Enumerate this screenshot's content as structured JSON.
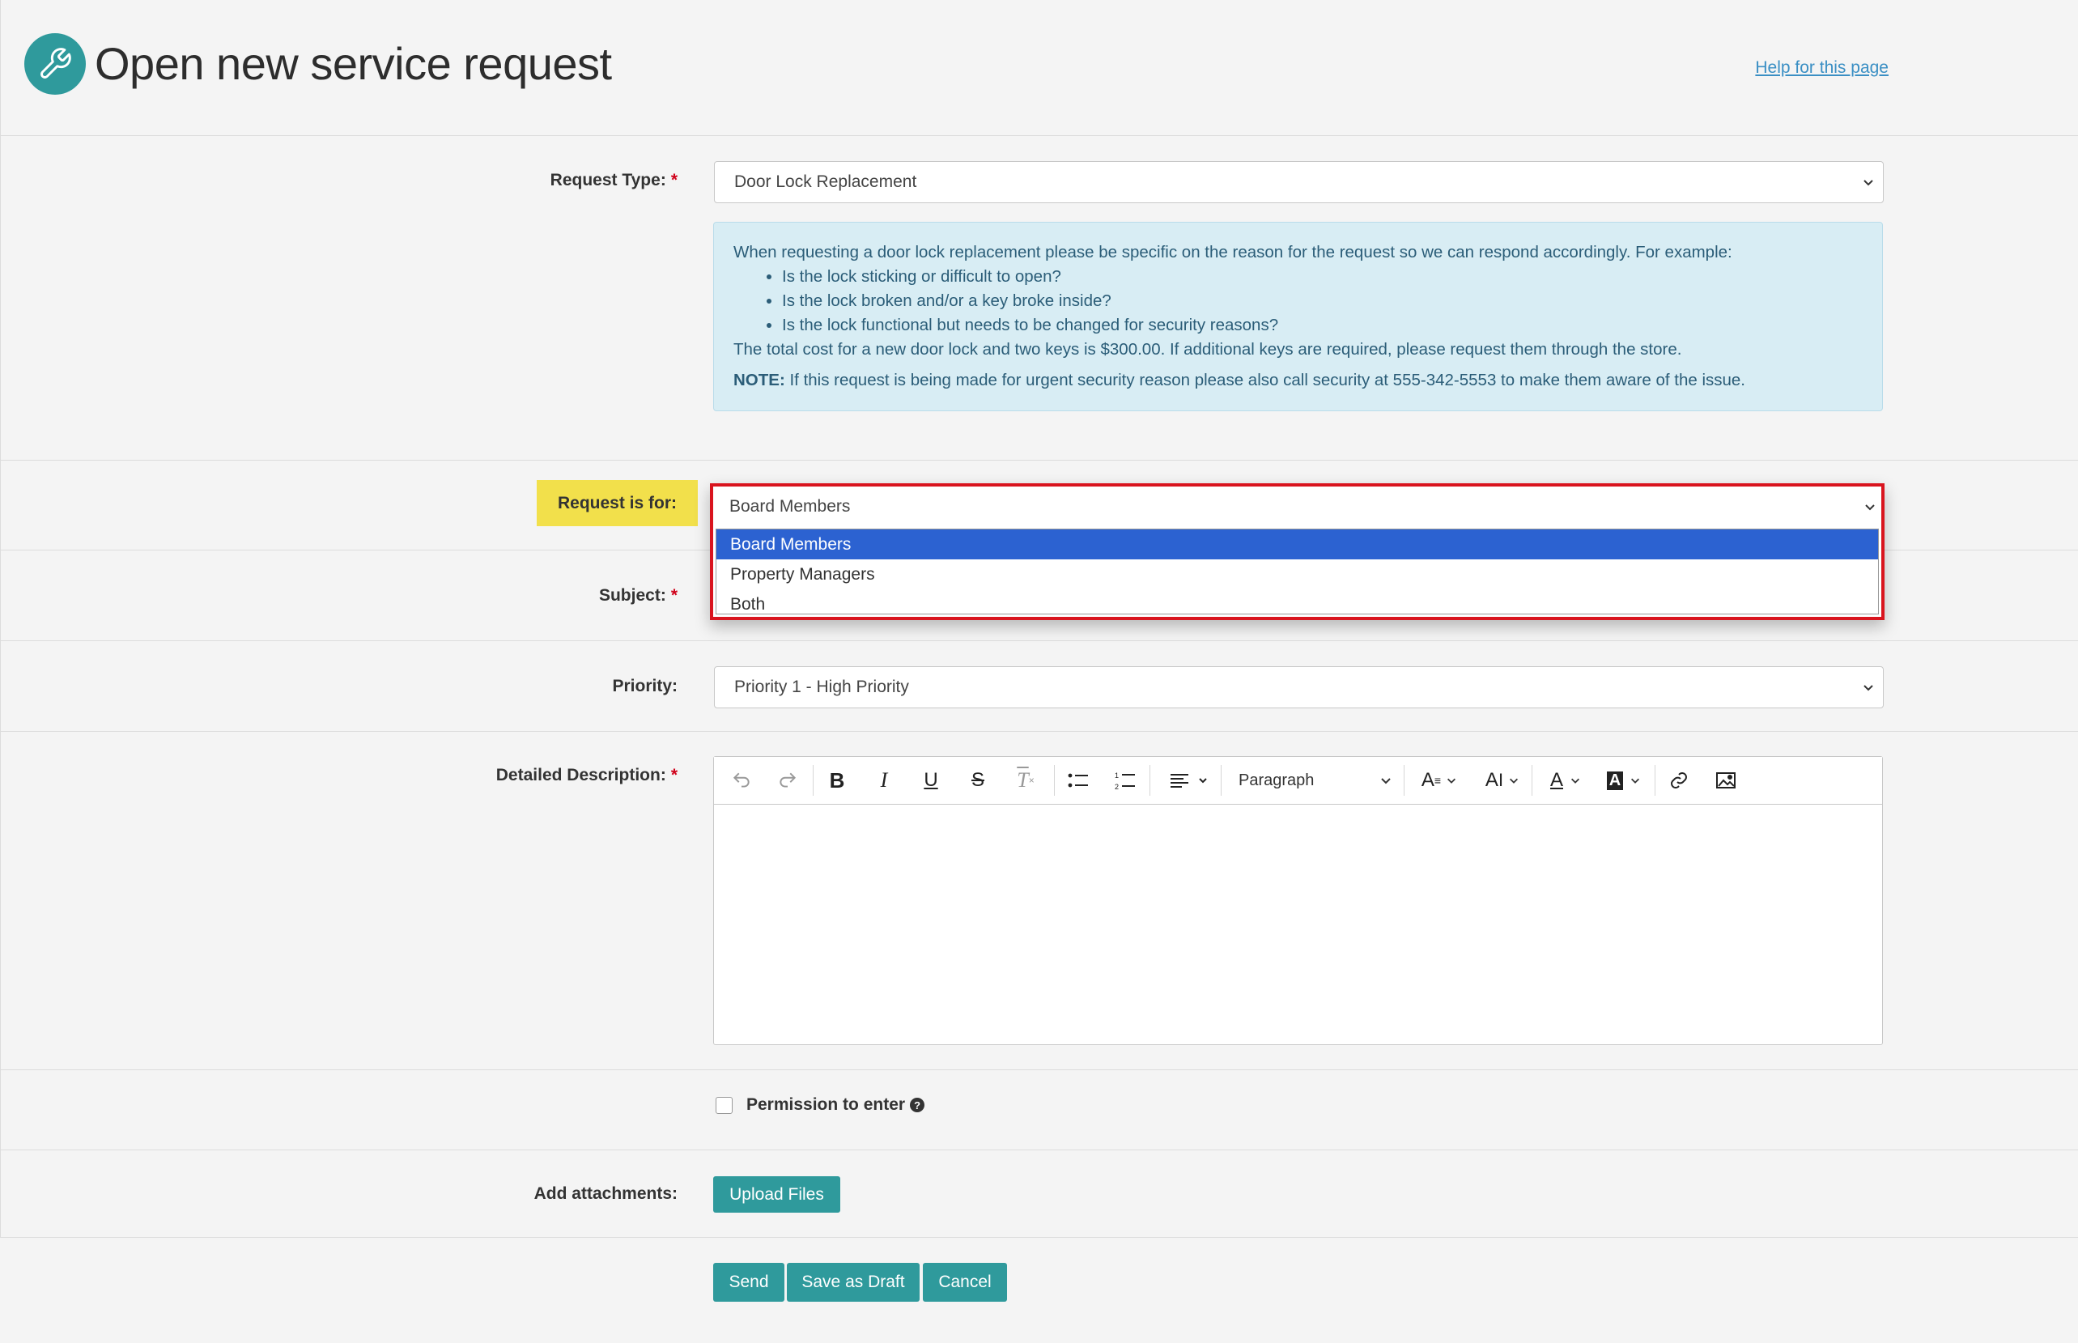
{
  "header": {
    "title": "Open new service request",
    "help_link": "Help for this page",
    "icon": "wrench-icon"
  },
  "request_type": {
    "label": "Request Type:",
    "required": "*",
    "value": "Door Lock Replacement"
  },
  "info": {
    "intro": "When requesting a door lock replacement please be specific on the reason for the request so we can respond accordingly. For example:",
    "bullets": [
      "Is the lock sticking or difficult to open?",
      "Is the lock broken and/or a key broke inside?",
      "Is the lock functional but needs to be changed for security reasons?"
    ],
    "cost": "The total cost for a new door lock and two keys is $300.00. If additional keys are required, please request them through the store.",
    "note_label": "NOTE:",
    "note_text": " If this request is being made for urgent security reason please also call security at 555-342-5553 to make them aware of the issue."
  },
  "request_for": {
    "label": "Request is for:",
    "value": "Board Members",
    "options": [
      "Board Members",
      "Property Managers",
      "Both"
    ],
    "selected_index": 0
  },
  "subject": {
    "label": "Subject:",
    "required": "*"
  },
  "priority": {
    "label": "Priority:",
    "value": "Priority 1 - High Priority"
  },
  "description": {
    "label": "Detailed Description:",
    "required": "*",
    "paragraph_style": "Paragraph",
    "toolbar_icons": [
      "undo-icon",
      "redo-icon",
      "bold-icon",
      "italic-icon",
      "underline-icon",
      "strikethrough-icon",
      "clear-format-icon",
      "bullet-list-icon",
      "numbered-list-icon",
      "align-icon",
      "font-size-icon",
      "line-height-icon",
      "font-color-icon",
      "highlight-color-icon",
      "link-icon",
      "image-icon"
    ]
  },
  "permission": {
    "label": "Permission to enter",
    "checked": false
  },
  "attachments": {
    "label": "Add attachments:",
    "button": "Upload Files"
  },
  "actions": {
    "send": "Send",
    "save_draft": "Save as Draft",
    "cancel": "Cancel"
  },
  "colors": {
    "accent": "#2f9a9c",
    "highlight": "#f2e04b",
    "selected_option": "#2c62d1",
    "focus_border": "#d9141e",
    "info_bg": "#d8edf4"
  }
}
